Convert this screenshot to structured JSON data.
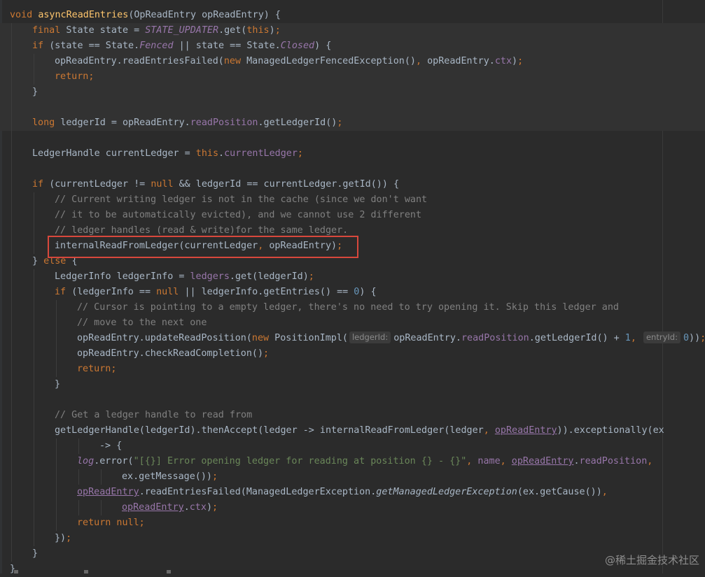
{
  "colors": {
    "background": "#2b2b2b",
    "keyword": "#cc7832",
    "default": "#a9b7c6",
    "method_decl": "#ffc66d",
    "constant_italic": "#9876aa",
    "field": "#9876aa",
    "comment": "#808080",
    "string": "#6a8759",
    "number": "#6897bb",
    "highlight_border": "#d8483c"
  },
  "watermark": "@稀土掘金技术社区",
  "lines": [
    {
      "indent": 0,
      "alt": false,
      "tokens": [
        {
          "t": "void ",
          "c": "#cc7832"
        },
        {
          "t": "asyncReadEntries",
          "c": "#ffc66d"
        },
        {
          "t": "(OpReadEntry opReadEntry) {",
          "c": "#a9b7c6"
        }
      ]
    },
    {
      "indent": 1,
      "alt": true,
      "tokens": [
        {
          "t": "final ",
          "c": "#cc7832"
        },
        {
          "t": "State state = ",
          "c": "#a9b7c6"
        },
        {
          "t": "STATE_UPDATER",
          "c": "#9876aa",
          "i": true
        },
        {
          "t": ".get(",
          "c": "#a9b7c6"
        },
        {
          "t": "this",
          "c": "#cc7832"
        },
        {
          "t": ")",
          "c": "#a9b7c6"
        },
        {
          "t": ";",
          "c": "#cc7832"
        }
      ]
    },
    {
      "indent": 1,
      "alt": true,
      "tokens": [
        {
          "t": "if ",
          "c": "#cc7832"
        },
        {
          "t": "(state == State.",
          "c": "#a9b7c6"
        },
        {
          "t": "Fenced",
          "c": "#9876aa",
          "i": true
        },
        {
          "t": " || state == State.",
          "c": "#a9b7c6"
        },
        {
          "t": "Closed",
          "c": "#9876aa",
          "i": true
        },
        {
          "t": ") {",
          "c": "#a9b7c6"
        }
      ]
    },
    {
      "indent": 2,
      "alt": true,
      "tokens": [
        {
          "t": "opReadEntry.readEntriesFailed(",
          "c": "#a9b7c6"
        },
        {
          "t": "new ",
          "c": "#cc7832"
        },
        {
          "t": "ManagedLedgerFencedException()",
          "c": "#a9b7c6"
        },
        {
          "t": ", ",
          "c": "#cc7832"
        },
        {
          "t": "opReadEntry.",
          "c": "#a9b7c6"
        },
        {
          "t": "ctx",
          "c": "#9876aa"
        },
        {
          "t": ")",
          "c": "#a9b7c6"
        },
        {
          "t": ";",
          "c": "#cc7832"
        }
      ]
    },
    {
      "indent": 2,
      "alt": true,
      "tokens": [
        {
          "t": "return;",
          "c": "#cc7832"
        }
      ]
    },
    {
      "indent": 1,
      "alt": true,
      "tokens": [
        {
          "t": "}",
          "c": "#a9b7c6"
        }
      ]
    },
    {
      "indent": 1,
      "alt": true,
      "tokens": []
    },
    {
      "indent": 1,
      "alt": true,
      "tokens": [
        {
          "t": "long ",
          "c": "#cc7832"
        },
        {
          "t": "ledgerId = opReadEntry.",
          "c": "#a9b7c6"
        },
        {
          "t": "readPosition",
          "c": "#9876aa"
        },
        {
          "t": ".getLedgerId()",
          "c": "#a9b7c6"
        },
        {
          "t": ";",
          "c": "#cc7832"
        }
      ]
    },
    {
      "indent": 1,
      "alt": false,
      "tokens": []
    },
    {
      "indent": 1,
      "alt": false,
      "tokens": [
        {
          "t": "LedgerHandle currentLedger = ",
          "c": "#a9b7c6"
        },
        {
          "t": "this",
          "c": "#cc7832"
        },
        {
          "t": ".",
          "c": "#a9b7c6"
        },
        {
          "t": "currentLedger",
          "c": "#9876aa"
        },
        {
          "t": ";",
          "c": "#cc7832"
        }
      ]
    },
    {
      "indent": 1,
      "alt": false,
      "tokens": []
    },
    {
      "indent": 1,
      "alt": false,
      "tokens": [
        {
          "t": "if ",
          "c": "#cc7832"
        },
        {
          "t": "(currentLedger != ",
          "c": "#a9b7c6"
        },
        {
          "t": "null ",
          "c": "#cc7832"
        },
        {
          "t": "&& ledgerId == currentLedger.getId()) {",
          "c": "#a9b7c6"
        }
      ]
    },
    {
      "indent": 2,
      "alt": false,
      "tokens": [
        {
          "t": "// Current writing ledger is not in the cache (since we don't want",
          "c": "#808080"
        }
      ]
    },
    {
      "indent": 2,
      "alt": false,
      "tokens": [
        {
          "t": "// it to be automatically evicted), and we cannot use 2 different",
          "c": "#808080"
        }
      ]
    },
    {
      "indent": 2,
      "alt": false,
      "tokens": [
        {
          "t": "// ledger handles (read & write)for the same ledger.",
          "c": "#808080"
        }
      ]
    },
    {
      "indent": 2,
      "alt": false,
      "tokens": [
        {
          "t": "internalReadFromLedger(currentLedger",
          "c": "#a9b7c6"
        },
        {
          "t": ", ",
          "c": "#cc7832"
        },
        {
          "t": "opReadEntry)",
          "c": "#a9b7c6"
        },
        {
          "t": ";",
          "c": "#cc7832"
        }
      ]
    },
    {
      "indent": 1,
      "alt": false,
      "tokens": [
        {
          "t": "} ",
          "c": "#a9b7c6"
        },
        {
          "t": "else ",
          "c": "#cc7832"
        },
        {
          "t": "{",
          "c": "#a9b7c6"
        }
      ]
    },
    {
      "indent": 2,
      "alt": false,
      "tokens": [
        {
          "t": "LedgerInfo ledgerInfo = ",
          "c": "#a9b7c6"
        },
        {
          "t": "ledgers",
          "c": "#9876aa"
        },
        {
          "t": ".get(ledgerId)",
          "c": "#a9b7c6"
        },
        {
          "t": ";",
          "c": "#cc7832"
        }
      ]
    },
    {
      "indent": 2,
      "alt": false,
      "tokens": [
        {
          "t": "if ",
          "c": "#cc7832"
        },
        {
          "t": "(ledgerInfo == ",
          "c": "#a9b7c6"
        },
        {
          "t": "null ",
          "c": "#cc7832"
        },
        {
          "t": "|| ledgerInfo.getEntries() == ",
          "c": "#a9b7c6"
        },
        {
          "t": "0",
          "c": "#6897bb"
        },
        {
          "t": ") {",
          "c": "#a9b7c6"
        }
      ]
    },
    {
      "indent": 3,
      "alt": false,
      "tokens": [
        {
          "t": "// Cursor is pointing to a empty ledger, there's no need to try opening it. Skip this ledger and",
          "c": "#808080"
        }
      ]
    },
    {
      "indent": 3,
      "alt": false,
      "tokens": [
        {
          "t": "// move to the next one",
          "c": "#808080"
        }
      ]
    },
    {
      "indent": 3,
      "alt": false,
      "tokens": [
        {
          "t": "opReadEntry.updateReadPosition(",
          "c": "#a9b7c6"
        },
        {
          "t": "new ",
          "c": "#cc7832"
        },
        {
          "t": "PositionImpl(",
          "c": "#a9b7c6"
        },
        {
          "hint": "ledgerId:"
        },
        {
          "t": "opReadEntry.",
          "c": "#a9b7c6"
        },
        {
          "t": "readPosition",
          "c": "#9876aa"
        },
        {
          "t": ".getLedgerId() + ",
          "c": "#a9b7c6"
        },
        {
          "t": "1",
          "c": "#6897bb"
        },
        {
          "t": ", ",
          "c": "#cc7832"
        },
        {
          "hint": "entryId:"
        },
        {
          "t": "0",
          "c": "#6897bb"
        },
        {
          "t": "))",
          "c": "#a9b7c6"
        },
        {
          "t": ";",
          "c": "#cc7832"
        }
      ]
    },
    {
      "indent": 3,
      "alt": false,
      "tokens": [
        {
          "t": "opReadEntry.checkReadCompletion()",
          "c": "#a9b7c6"
        },
        {
          "t": ";",
          "c": "#cc7832"
        }
      ]
    },
    {
      "indent": 3,
      "alt": false,
      "tokens": [
        {
          "t": "return;",
          "c": "#cc7832"
        }
      ]
    },
    {
      "indent": 2,
      "alt": false,
      "tokens": [
        {
          "t": "}",
          "c": "#a9b7c6"
        }
      ]
    },
    {
      "indent": 2,
      "alt": false,
      "tokens": []
    },
    {
      "indent": 2,
      "alt": false,
      "tokens": [
        {
          "t": "// Get a ledger handle to read from",
          "c": "#808080"
        }
      ]
    },
    {
      "indent": 2,
      "alt": false,
      "tokens": [
        {
          "t": "getLedgerHandle(ledgerId).thenAccept(ledger -> internalReadFromLedger(ledger",
          "c": "#a9b7c6"
        },
        {
          "t": ", ",
          "c": "#cc7832"
        },
        {
          "t": "opReadEntry",
          "c": "#9876aa",
          "u": true
        },
        {
          "t": ")).exceptionally(ex",
          "c": "#a9b7c6"
        }
      ]
    },
    {
      "indent": 4,
      "alt": false,
      "tokens": [
        {
          "t": "-> {",
          "c": "#a9b7c6"
        }
      ]
    },
    {
      "indent": 3,
      "alt": false,
      "tokens": [
        {
          "t": "log",
          "c": "#9876aa",
          "i": true
        },
        {
          "t": ".error(",
          "c": "#a9b7c6"
        },
        {
          "t": "\"[{}] Error opening ledger for reading at position {} - {}\"",
          "c": "#6a8759"
        },
        {
          "t": ", ",
          "c": "#cc7832"
        },
        {
          "t": "name",
          "c": "#9876aa"
        },
        {
          "t": ", ",
          "c": "#cc7832"
        },
        {
          "t": "opReadEntry",
          "c": "#9876aa",
          "u": true
        },
        {
          "t": ".",
          "c": "#a9b7c6"
        },
        {
          "t": "readPosition",
          "c": "#9876aa"
        },
        {
          "t": ",",
          "c": "#cc7832"
        }
      ]
    },
    {
      "indent": 5,
      "alt": false,
      "tokens": [
        {
          "t": "ex.getMessage())",
          "c": "#a9b7c6"
        },
        {
          "t": ";",
          "c": "#cc7832"
        }
      ]
    },
    {
      "indent": 3,
      "alt": false,
      "tokens": [
        {
          "t": "opReadEntry",
          "c": "#9876aa",
          "u": true
        },
        {
          "t": ".readEntriesFailed(ManagedLedgerException.",
          "c": "#a9b7c6"
        },
        {
          "t": "getManagedLedgerException",
          "c": "#a9b7c6",
          "i": true
        },
        {
          "t": "(ex.getCause())",
          "c": "#a9b7c6"
        },
        {
          "t": ",",
          "c": "#cc7832"
        }
      ]
    },
    {
      "indent": 5,
      "alt": false,
      "tokens": [
        {
          "t": "opReadEntry",
          "c": "#9876aa",
          "u": true
        },
        {
          "t": ".",
          "c": "#a9b7c6"
        },
        {
          "t": "ctx",
          "c": "#9876aa"
        },
        {
          "t": ")",
          "c": "#a9b7c6"
        },
        {
          "t": ";",
          "c": "#cc7832"
        }
      ]
    },
    {
      "indent": 3,
      "alt": false,
      "tokens": [
        {
          "t": "return null;",
          "c": "#cc7832"
        }
      ]
    },
    {
      "indent": 2,
      "alt": false,
      "tokens": [
        {
          "t": "})",
          "c": "#a9b7c6"
        },
        {
          "t": ";",
          "c": "#cc7832"
        }
      ]
    },
    {
      "indent": 1,
      "alt": false,
      "tokens": [
        {
          "t": "}",
          "c": "#a9b7c6"
        }
      ]
    },
    {
      "indent": 0,
      "alt": false,
      "tokens": [
        {
          "t": "}",
          "c": "#a9b7c6"
        }
      ]
    }
  ]
}
